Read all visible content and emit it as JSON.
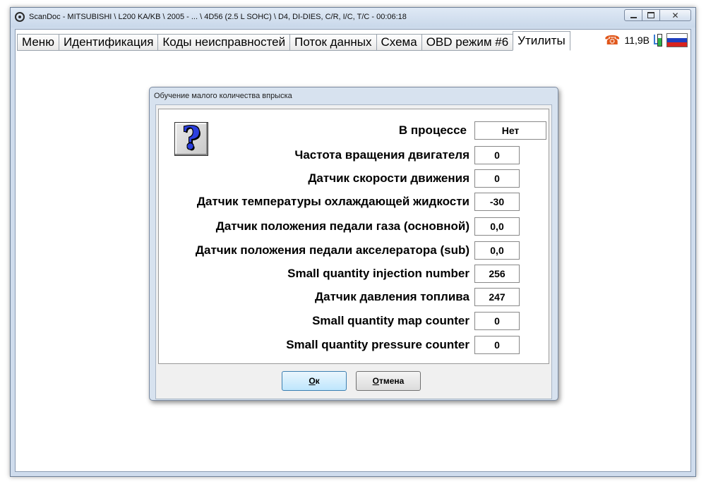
{
  "window": {
    "title": "ScanDoc - MITSUBISHI \\ L200 KA/KB \\ 2005 - ... \\ 4D56 (2.5 L SOHC) \\ D4, DI-DIES, C/R, I/C, T/C - 00:06:18",
    "close_glyph": "✕"
  },
  "tabs": [
    {
      "label": "Меню"
    },
    {
      "label": "Идентификация"
    },
    {
      "label": "Коды неисправностей"
    },
    {
      "label": "Поток данных"
    },
    {
      "label": "Схема"
    },
    {
      "label": "OBD режим #6"
    },
    {
      "label": "Утилиты",
      "active": true
    }
  ],
  "status": {
    "phone_glyph": "☎",
    "voltage": "11,9В",
    "phone_color": "#e0561a",
    "battery_color": "#2fb34a",
    "flag_colors": [
      "#ffffff",
      "#1f3fbf",
      "#d8231f"
    ]
  },
  "dialog": {
    "title": "Обучение малого количества впрыска",
    "help_glyph": "?",
    "rows": [
      {
        "label": "В процессе",
        "value": "Нет"
      },
      {
        "label": "Частота вращения двигателя",
        "value": "0"
      },
      {
        "label": "Датчик скорости движения",
        "value": "0"
      },
      {
        "label": "Датчик температуры охлаждающей жидкости",
        "value": "-30"
      },
      {
        "label": "Датчик положения педали газа (основной)",
        "value": "0,0"
      },
      {
        "label": "Датчик положения педали акселератора (sub)",
        "value": "0,0"
      },
      {
        "label": "Small quantity injection number",
        "value": "256"
      },
      {
        "label": "Датчик давления топлива",
        "value": "247"
      },
      {
        "label": "Small quantity map counter",
        "value": "0"
      },
      {
        "label": "Small quantity pressure counter",
        "value": "0"
      }
    ],
    "ok_hotkey": "О",
    "ok_rest": "к",
    "cancel_hotkey": "О",
    "cancel_rest": "тмена"
  }
}
